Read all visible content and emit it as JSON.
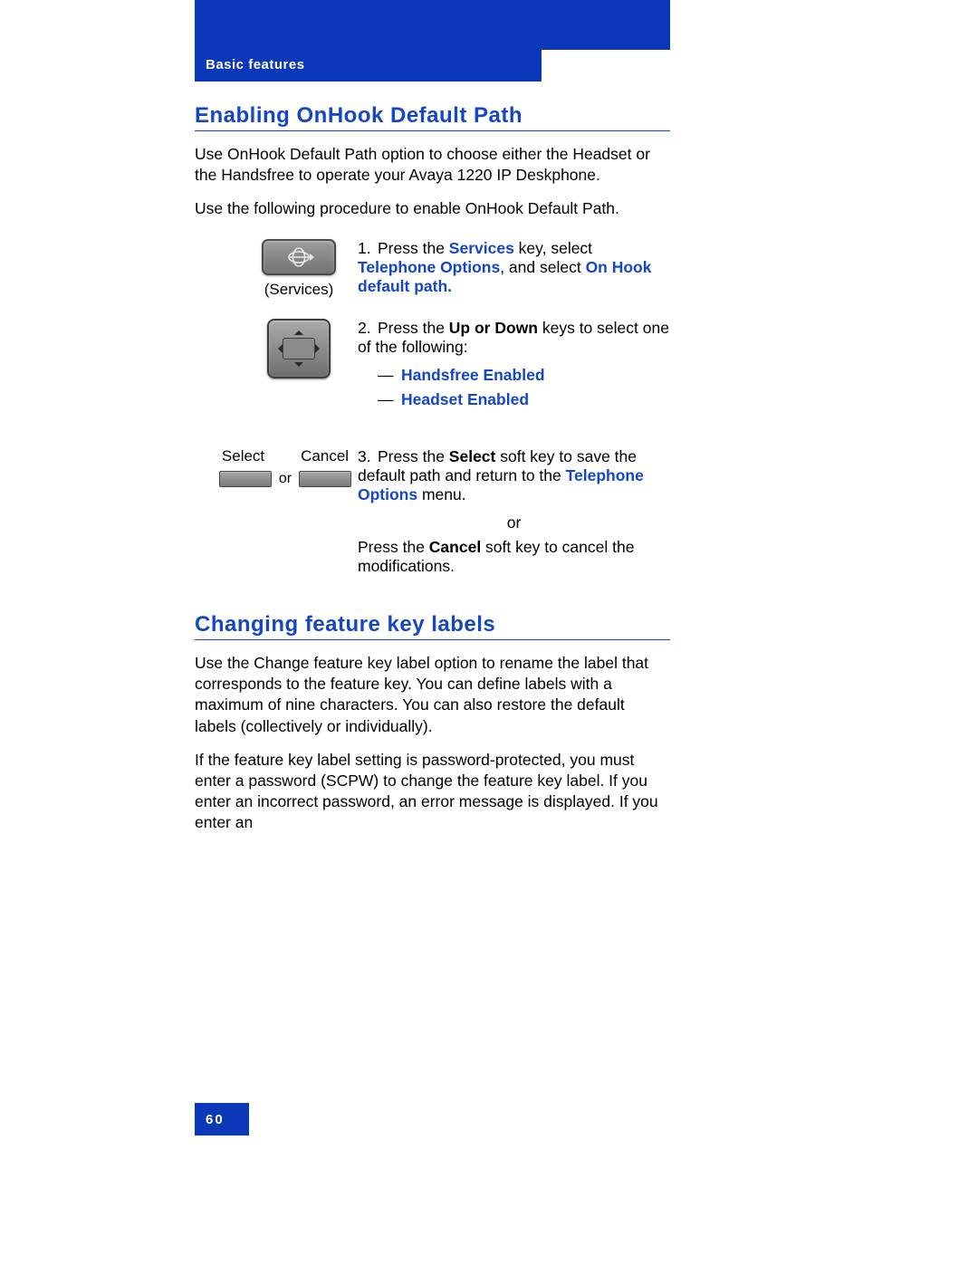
{
  "header": {
    "chapter": "Basic features"
  },
  "section1": {
    "title": "Enabling OnHook Default Path",
    "intro1": "Use OnHook Default Path option to choose either the Headset or the Handsfree to operate your Avaya 1220 IP Deskphone.",
    "intro2": "Use the following procedure to enable OnHook Default Path."
  },
  "step1": {
    "caption": "(Services)",
    "num": "1.",
    "t1": "Press the ",
    "link1": "Services",
    "t2": " key, select ",
    "link2": "Telephone Options",
    "t3": ", and select ",
    "link3": "On Hook default path."
  },
  "step2": {
    "num": "2.",
    "t1": "Press the ",
    "bold1": "Up or Down",
    "t2": " keys to select one of the following:",
    "opt1": "Handsfree Enabled",
    "opt2": "Headset Enabled",
    "dash": "—"
  },
  "step3": {
    "labelSelect": "Select",
    "labelCancel": "Cancel",
    "or": "or",
    "num": "3.",
    "t1": "Press the ",
    "boldSelect": "Select",
    "t2": " soft key to save the default path and return to the ",
    "linkTO": "Telephone Options",
    "t3": " menu.",
    "centerOr": "or",
    "t4": "Press the ",
    "boldCancel": "Cancel",
    "t5": " soft key to cancel the modifications."
  },
  "section2": {
    "title": "Changing feature key labels",
    "p1": "Use the Change feature key label option to rename the label that corresponds to the feature key. You can define labels with a maximum of nine characters. You can also restore the default labels (collectively or individually).",
    "p2": "If the feature key label setting is password-protected, you must enter a password (SCPW) to change the feature key label. If you enter an incorrect password, an error message is displayed. If you enter an"
  },
  "pageNumber": "60"
}
